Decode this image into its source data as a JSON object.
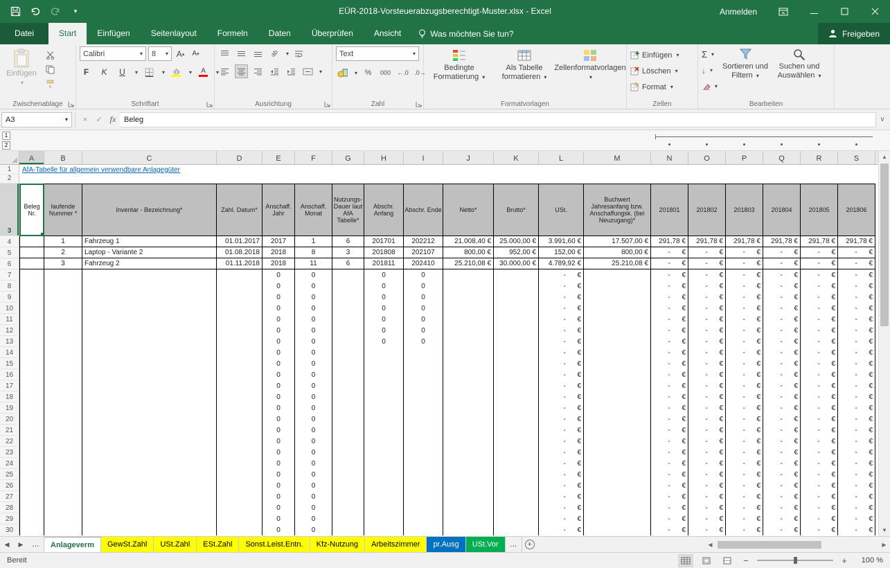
{
  "app": {
    "accent_color": "#217346",
    "title": "EÜR-2018-Vorsteuerabzugsberechtigt-Muster.xlsx - Excel",
    "sign_in_label": "Anmelden"
  },
  "ribbon": {
    "tabs": [
      "Datei",
      "Start",
      "Einfügen",
      "Seitenlayout",
      "Formeln",
      "Daten",
      "Überprüfen",
      "Ansicht"
    ],
    "active_tab": "Start",
    "tell_me": "Was möchten Sie tun?",
    "share_label": "Freigeben",
    "clipboard": {
      "label": "Zwischenablage",
      "paste": "Einfügen"
    },
    "font": {
      "label": "Schriftart",
      "font_name": "Calibri",
      "font_size": "8"
    },
    "alignment": {
      "label": "Ausrichtung"
    },
    "number": {
      "label": "Zahl",
      "format": "Text"
    },
    "styles": {
      "label": "Formatvorlagen",
      "conditional": "Bedingte Formatierung",
      "as_table": "Als Tabelle formatieren",
      "cell_styles": "Zellenformatvorlagen"
    },
    "cells": {
      "label": "Zellen",
      "insert": "Einfügen",
      "delete": "Löschen",
      "format": "Format"
    },
    "editing": {
      "label": "Bearbeiten",
      "sort": "Sortieren und Filtern",
      "find": "Suchen und Auswählen"
    }
  },
  "formula_bar": {
    "name_box": "A3",
    "content": "Beleg"
  },
  "outline": {
    "levels": [
      "1",
      "2"
    ]
  },
  "grid": {
    "columns": [
      "A",
      "B",
      "C",
      "D",
      "E",
      "F",
      "G",
      "H",
      "I",
      "J",
      "K",
      "L",
      "M",
      "N",
      "O",
      "P",
      "Q",
      "R",
      "S"
    ],
    "row1_link": "AfA-Tabelle für allgemein verwendbare Anlagegüter",
    "header_row": [
      "Beleg Nr.",
      "laufende Nummer *",
      "Inventar - Bezeichnung*",
      "Zahl. Datum*",
      "Anschaff. Jahr",
      "Anschaff. Monat",
      "Nutzungs-Dauer laut AfA Tabelle*",
      "Abschr. Anfang",
      "Abschr. Ende",
      "Netto*",
      "Brutto*",
      "USt.",
      "Buchwert Jahresanfang bzw. Anschaffungsk. (bei Neuzugang)*",
      "201801",
      "201802",
      "201803",
      "201804",
      "201805",
      "201806"
    ],
    "data_rows": [
      [
        "",
        "1",
        "Fahrzeug 1",
        "01.01.2017",
        "2017",
        "1",
        "6",
        "201701",
        "202212",
        "21.008,40 €",
        "25.000,00 €",
        "3.991,60 €",
        "17.507,00 €",
        "291,78 €",
        "291,78 €",
        "291,78 €",
        "291,78 €",
        "291,78 €",
        "291,78 €"
      ],
      [
        "",
        "2",
        "Laptop - Variante 2",
        "01.08.2018",
        "2018",
        "8",
        "3",
        "201808",
        "202107",
        "800,00 €",
        "952,00 €",
        "152,00 €",
        "800,00 €",
        "-      €",
        "-      €",
        "-      €",
        "-      €",
        "-      €",
        "-      €"
      ],
      [
        "",
        "3",
        "Fahrzeug 2",
        "01.11.2018",
        "2018",
        "11",
        "6",
        "201811",
        "202410",
        "25.210,08 €",
        "30.000,00 €",
        "4.789,92 €",
        "25.210,08 €",
        "-      €",
        "-      €",
        "-      €",
        "-      €",
        "-      €",
        "-      €"
      ]
    ],
    "filler_rows": [
      {
        "from": 7,
        "to": 13,
        "cells": [
          "",
          "",
          "",
          "",
          "0",
          "0",
          "",
          "0",
          "0",
          "",
          "",
          "-      €",
          "",
          "-      €",
          "-      €",
          "-      €",
          "-      €",
          "-      €",
          "-      €"
        ]
      },
      {
        "from": 14,
        "to": 30,
        "cells": [
          "",
          "",
          "",
          "",
          "0",
          "0",
          "",
          "",
          "",
          "",
          "",
          "-      €",
          "",
          "-      €",
          "-      €",
          "-      €",
          "-      €",
          "-      €",
          "-      €"
        ]
      }
    ]
  },
  "sheet_tabs": {
    "items": [
      {
        "label": "…",
        "name": "overflow-left",
        "more": true
      },
      {
        "label": "Anlageverm",
        "active": true
      },
      {
        "label": "GewSt.Zahl",
        "color": "#FFFF00"
      },
      {
        "label": "USt.Zahl",
        "color": "#FFFF00"
      },
      {
        "label": "ESt.Zahl",
        "color": "#FFFF00"
      },
      {
        "label": "Sonst.Leist.Entn.",
        "color": "#FFFF00"
      },
      {
        "label": "Kfz-Nutzung",
        "color": "#FFFF00"
      },
      {
        "label": "Arbeitszimmer",
        "color": "#FFFF00"
      },
      {
        "label": "pr.Ausg",
        "color": "#0070C0",
        "text": "#FFFFFF"
      },
      {
        "label": "USt.Vor",
        "color": "#00B050",
        "text": "#FFFFFF"
      },
      {
        "label": "…",
        "name": "overflow-right",
        "more": true
      }
    ]
  },
  "status_bar": {
    "mode": "Bereit",
    "zoom": "100 %"
  }
}
